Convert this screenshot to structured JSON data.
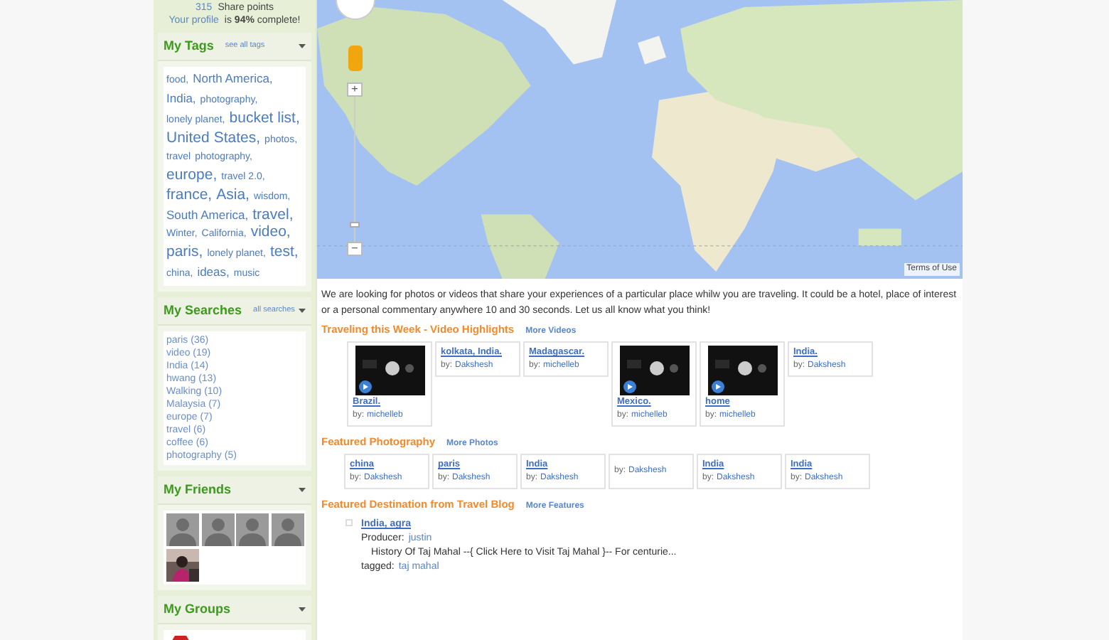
{
  "profile": {
    "points_count": "315",
    "points_label": "Share points",
    "profile_link": "Your profile",
    "profile_text": "is **94%** complete!"
  },
  "tags_panel": {
    "title": "My Tags",
    "link": "see all tags",
    "tags": [
      {
        "text": "food,",
        "kind": "small"
      },
      {
        "text": "North America,",
        "kind": "medium"
      },
      {
        "text": "India,",
        "kind": "medium"
      },
      {
        "text": "photography,",
        "kind": "small"
      },
      {
        "text": "lonely planet,",
        "kind": "small"
      },
      {
        "text": "bucket list,",
        "kind": "large"
      },
      {
        "text": "United",
        "kind": "large"
      },
      {
        "text": "States,",
        "kind": "large"
      },
      {
        "text": "photos,",
        "kind": "small"
      },
      {
        "text": "travel",
        "kind": "small"
      },
      {
        "text": "photography,",
        "kind": "small"
      },
      {
        "text": "europe,",
        "kind": "large"
      },
      {
        "text": "travel 2.0,",
        "kind": "small"
      },
      {
        "text": "france,",
        "kind": "large"
      },
      {
        "text": "Asia,",
        "kind": "large"
      },
      {
        "text": "wisdom,",
        "kind": "small"
      },
      {
        "text": "South America,",
        "kind": "medium"
      },
      {
        "text": "travel,",
        "kind": "large"
      },
      {
        "text": "Winter,",
        "kind": "small"
      },
      {
        "text": "California,",
        "kind": "small"
      },
      {
        "text": "video,",
        "kind": "large"
      },
      {
        "text": "paris,",
        "kind": "large"
      },
      {
        "text": "lonely planet,",
        "kind": "small"
      },
      {
        "text": "test,",
        "kind": "large"
      },
      {
        "text": "china,",
        "kind": "small"
      },
      {
        "text": "ideas,",
        "kind": "medium"
      },
      {
        "text": "music",
        "kind": "small"
      }
    ]
  },
  "searches_panel": {
    "title": "My Searches",
    "link": "all searches",
    "items": [
      "paris (36)",
      "video (19)",
      "India (14)",
      "hwang (13)",
      "Walking (10)",
      "Malaysia (7)",
      "europe (7)",
      "travel (6)",
      "coffee (6)",
      "photography (5)"
    ]
  },
  "friends_panel": {
    "title": "My Friends",
    "friends": [
      {
        "kind": "silhouette"
      },
      {
        "kind": "silhouette"
      },
      {
        "kind": "silhouette"
      },
      {
        "kind": "silhouette"
      },
      {
        "kind": "picture"
      }
    ]
  },
  "groups_panel": {
    "title": "My Groups"
  },
  "map": {
    "terms": "Terms of Use",
    "zoom_in": "+",
    "zoom_out": "−",
    "zoom": {
      "level": 0.1
    }
  },
  "intro": "We are looking for photos or videos that share your experiences of a particular place whilw you are traveling. It could be a hotel, place of interest or a personal commentary anywhere 10 and 30 seconds. Let us all know what you think!",
  "video_section": {
    "title": "Traveling this Week - Video Highlights",
    "link": "More Videos",
    "items": [
      {
        "kind": "video",
        "title": "Brazil.",
        "by": "by:",
        "author": "michelleb"
      },
      {
        "kind": "text",
        "title": "kolkata, India.",
        "by": "by:",
        "author": "Dakshesh"
      },
      {
        "kind": "text",
        "title": "Madagascar.",
        "by": "by:",
        "author": "michelleb"
      },
      {
        "kind": "video",
        "title": "Mexico.",
        "by": "by:",
        "author": "michelleb"
      },
      {
        "kind": "video",
        "title": "home",
        "by": "by:",
        "author": "michelleb"
      },
      {
        "kind": "text",
        "title": "India.",
        "by": "by:",
        "author": "Dakshesh"
      }
    ]
  },
  "photo_section": {
    "title": "Featured Photography",
    "link": "More Photos",
    "items": [
      {
        "title": "china",
        "by": "by:",
        "author": "Dakshesh"
      },
      {
        "title": "paris",
        "by": "by:",
        "author": "Dakshesh"
      },
      {
        "title": "India",
        "by": "by:",
        "author": "Dakshesh"
      },
      {
        "by": "by:",
        "author": "Dakshesh"
      },
      {
        "title": "India",
        "by": "by:",
        "author": "Dakshesh"
      },
      {
        "title": "India",
        "by": "by:",
        "author": "Dakshesh"
      }
    ]
  },
  "blog_section": {
    "title": "Featured Destination from Travel Blog",
    "link": "More Features",
    "entry": {
      "title": "India, agra",
      "producer_label": "Producer:",
      "producer": "justin",
      "summary": "History Of Taj Mahal --{ Click Here to Visit Taj Mahal }-- For centurie...",
      "tagged_label": "tagged:",
      "tag": "taj mahal"
    }
  }
}
